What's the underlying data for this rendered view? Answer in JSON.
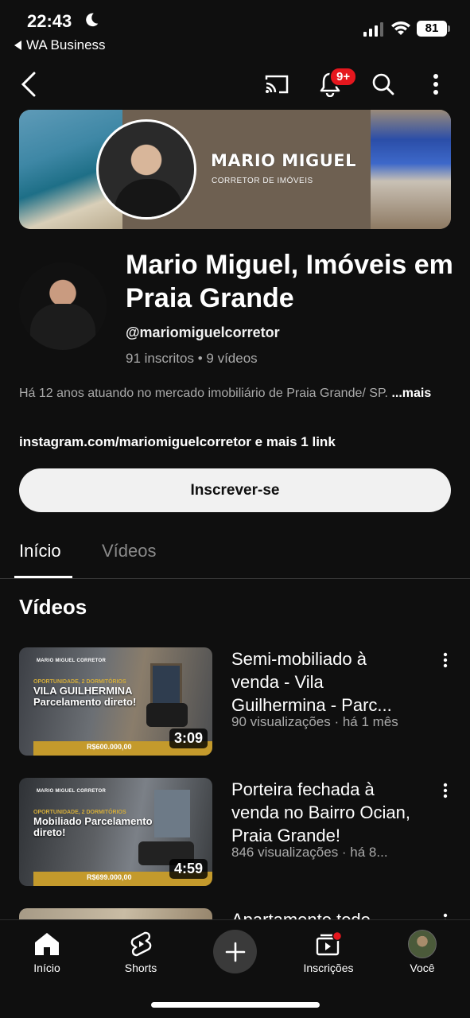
{
  "status_bar": {
    "time": "22:43",
    "back_app": "WA Business",
    "battery": "81"
  },
  "top_nav": {
    "notification_badge": "9+"
  },
  "banner": {
    "title": "MARIO MIGUEL",
    "subtitle": "CORRETOR DE IMÓVEIS"
  },
  "channel": {
    "name": "Mario Miguel, Imóveis em Praia Grande",
    "handle": "@mariomiguelcorretor",
    "subscribers": "91 inscritos",
    "videos_count": "9 vídeos",
    "description": "Há 12 anos atuando no mercado imobiliário de Praia Grande/ SP.",
    "more_label": "...mais",
    "link": "instagram.com/mariomiguelcorretor",
    "more_links": "e mais 1 link",
    "subscribe_label": "Inscrever-se"
  },
  "tabs": [
    {
      "label": "Início",
      "active": true
    },
    {
      "label": "Vídeos",
      "active": false
    }
  ],
  "section_title": "Vídeos",
  "videos": [
    {
      "title": "Semi-mobiliado à venda - Vila Guilhermina - Parc...",
      "meta": "90 visualizações · há 1 mês",
      "duration": "3:09",
      "thumb_brand": "MARIO MIGUEL CORRETOR",
      "thumb_kicker": "OPORTUNIDADE, 2 DORMITÓRIOS",
      "thumb_head": "VILA GUILHERMINA Parcelamento direto!",
      "thumb_price": "R$600.000,00"
    },
    {
      "title": "Porteira fechada à venda no Bairro Ocian, Praia Grande!",
      "meta": "846 visualizações · há 8...",
      "duration": "4:59",
      "thumb_brand": "MARIO MIGUEL CORRETOR",
      "thumb_kicker": "OPORTUNIDADE, 2 DORMITÓRIOS",
      "thumb_head": "Mobiliado Parcelamento direto!",
      "thumb_price": "R$699.000,00"
    },
    {
      "title": "Apartamento todo",
      "meta": "",
      "duration": ""
    }
  ],
  "bottom_nav": [
    {
      "label": "Início",
      "icon": "home-icon"
    },
    {
      "label": "Shorts",
      "icon": "shorts-icon"
    },
    {
      "label": "",
      "icon": "plus-icon"
    },
    {
      "label": "Inscrições",
      "icon": "subscriptions-icon"
    },
    {
      "label": "Você",
      "icon": "avatar"
    }
  ],
  "colors": {
    "background": "#0f0f0f",
    "subscribe_bg": "#f1f1f1",
    "badge": "#e5171e",
    "price_bar": "#c49a2c"
  }
}
